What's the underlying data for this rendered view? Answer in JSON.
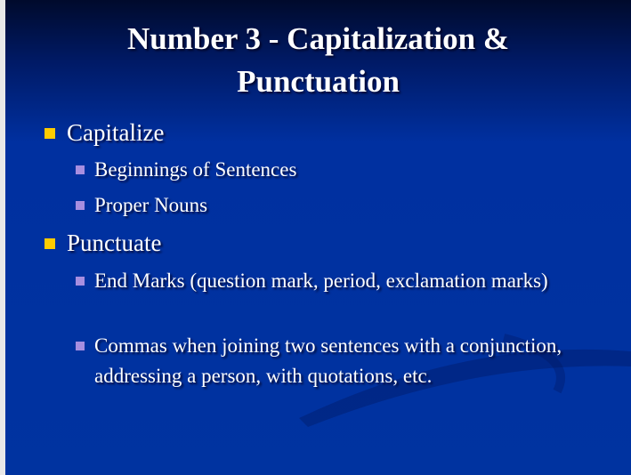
{
  "title": "Number 3 - Capitalization & Punctuation",
  "items": [
    {
      "label": "Capitalize",
      "sub": [
        "Beginnings of Sentences",
        "Proper Nouns"
      ]
    },
    {
      "label": "Punctuate",
      "sub": [
        "End Marks (question mark, period, exclamation marks)",
        "Commas when joining two sentences with a conjunction, addressing a person, with quotations, etc."
      ]
    }
  ]
}
